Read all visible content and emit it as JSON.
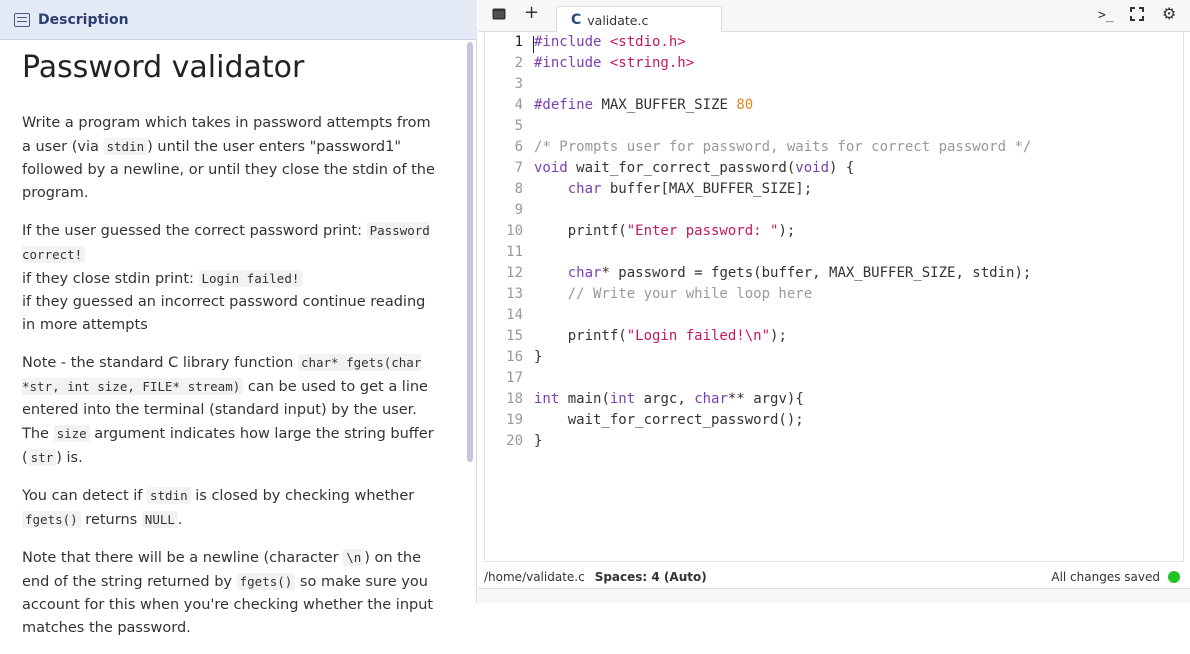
{
  "left_panel": {
    "tab_label": "Description",
    "title": "Password validator",
    "p1": "Write a program which takes in password attempts from a user (via",
    "p1_code": "stdin",
    "p1_rest": ") until the user enters \"password1\" followed by a newline, or until they close the stdin of the program.",
    "p2_a": "If the user guessed the correct password print: ",
    "p2_code1": "Password correct!",
    "p2_b": "if they close stdin print: ",
    "p2_code2": "Login failed!",
    "p2_c": "if they guessed an incorrect password continue reading in more attempts",
    "p3_a": "Note - the standard C library function ",
    "p3_code1": "char* fgets(char *str, int size, FILE* stream)",
    "p3_b": " can be used to get a line entered into the terminal (standard input) by the user. The ",
    "p3_code2": "size",
    "p3_c": " argument indicates how large the string buffer (",
    "p3_code3": "str",
    "p3_d": ") is.",
    "p4_a": "You can detect if ",
    "p4_code1": "stdin",
    "p4_b": " is closed by checking whether ",
    "p4_code2": "fgets()",
    "p4_c": " returns ",
    "p4_code3": "NULL",
    "p4_d": ".",
    "p5_a": "Note that there will be a newline (character ",
    "p5_code1": "\\n",
    "p5_b": ") on the end of the string returned by ",
    "p5_code2": "fgets()",
    "p5_c": " so make sure you account for this when you're checking whether the input matches the password."
  },
  "editor": {
    "tab_icon": "C",
    "tab_filename": "validate.c",
    "toolbar_icons": [
      "terminal-panel-icon",
      "plus-icon",
      "console-icon",
      "fullscreen-icon",
      "gear-icon"
    ],
    "toolbar_plus": "+",
    "toolbar_console": ">_",
    "toolbar_fullscreen": "⛶",
    "toolbar_gear": "⚙",
    "lines": [
      {
        "n": "1",
        "text": "#include <stdio.h>"
      },
      {
        "n": "2",
        "text": "#include <string.h>"
      },
      {
        "n": "3",
        "text": ""
      },
      {
        "n": "4",
        "text": "#define MAX_BUFFER_SIZE 80"
      },
      {
        "n": "5",
        "text": ""
      },
      {
        "n": "6",
        "text": "/* Prompts user for password, waits for correct password */"
      },
      {
        "n": "7",
        "text": "void wait_for_correct_password(void) {"
      },
      {
        "n": "8",
        "text": "    char buffer[MAX_BUFFER_SIZE];"
      },
      {
        "n": "9",
        "text": ""
      },
      {
        "n": "10",
        "text": "    printf(\"Enter password: \");"
      },
      {
        "n": "11",
        "text": ""
      },
      {
        "n": "12",
        "text": "    char* password = fgets(buffer, MAX_BUFFER_SIZE, stdin);"
      },
      {
        "n": "13",
        "text": "    // Write your while loop here"
      },
      {
        "n": "14",
        "text": ""
      },
      {
        "n": "15",
        "text": "    printf(\"Login failed!\\n\");"
      },
      {
        "n": "16",
        "text": "}"
      },
      {
        "n": "17",
        "text": ""
      },
      {
        "n": "18",
        "text": "int main(int argc, char** argv){"
      },
      {
        "n": "19",
        "text": "    wait_for_correct_password();"
      },
      {
        "n": "20",
        "text": "}"
      }
    ]
  },
  "status_bar": {
    "path": "/home/validate.c",
    "spaces": "Spaces: 4 (Auto)",
    "saved": "All changes saved",
    "saved_color": "#22c422"
  },
  "colors": {
    "keyword": "#7a3fb0",
    "string": "#c4195b",
    "number": "#e08a1e",
    "comment": "#999999",
    "header_bg": "#e3eaf6"
  }
}
